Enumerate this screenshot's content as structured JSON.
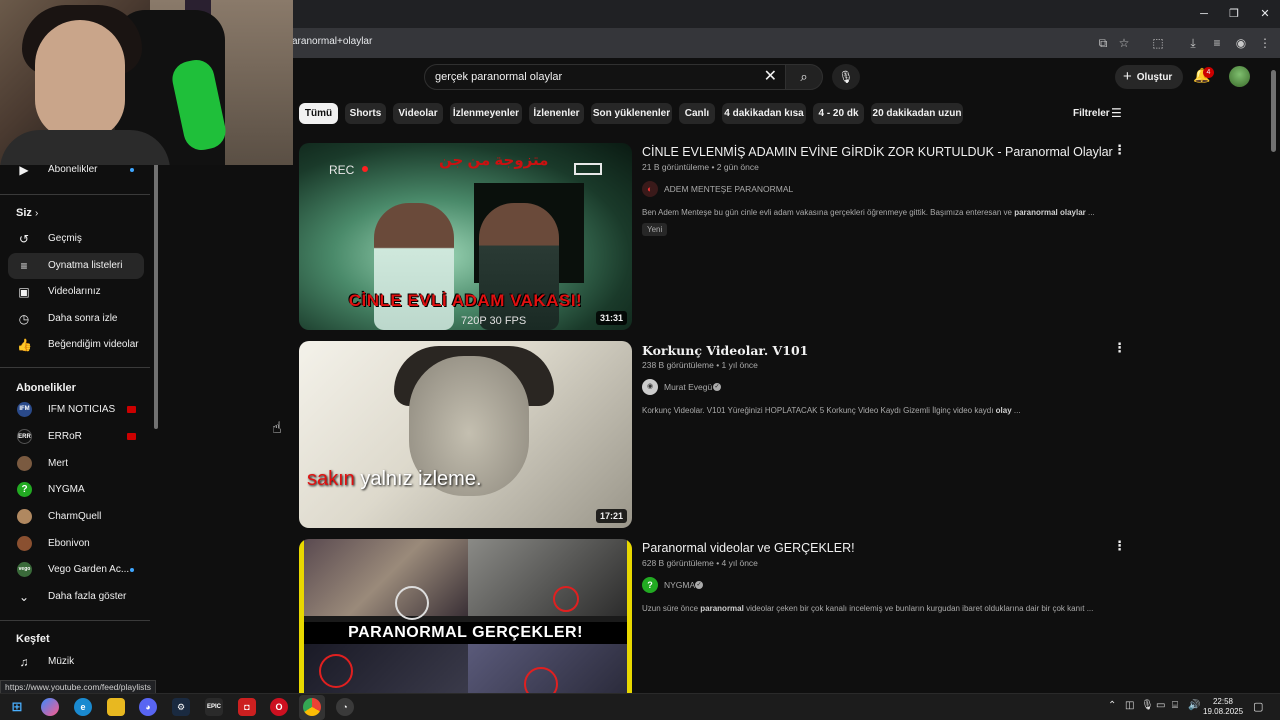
{
  "browser": {
    "url": "aranormal+olaylar",
    "status_url": "https://www.youtube.com/feed/playlists"
  },
  "topbar": {
    "search_query": "gerçek paranormal olaylar",
    "create_label": "Oluştur",
    "notification_count": "4"
  },
  "chips": [
    "Tümü",
    "Shorts",
    "Videolar",
    "İzlenmeyenler",
    "İzlenenler",
    "Son yüklenenler",
    "Canlı",
    "4 dakikadan kısa",
    "4 - 20 dk",
    "20 dakikadan uzun"
  ],
  "filters_label": "Filtreler",
  "sidebar": {
    "subscriptions_item": "Abonelikler",
    "you_header": "Siz",
    "you_items": [
      "Geçmiş",
      "Oynatma listeleri",
      "Videolarınız",
      "Daha sonra izle",
      "Beğendiğim videolar"
    ],
    "subs_header": "Abonelikler",
    "channels": [
      "IFM NOTICIAS",
      "ERRoR",
      "Mert",
      "NYGMA",
      "CharmQuell",
      "Ebonivon",
      "Vego Garden Ac..."
    ],
    "channel_avatar_text": [
      "IFM",
      "ERR",
      "",
      "?",
      "",
      "",
      "vego"
    ],
    "show_more": "Daha fazla göster",
    "explore_header": "Keşfet",
    "music": "Müzik"
  },
  "results": [
    {
      "title": "CİNLE EVLENMİŞ ADAMIN EVİNE GİRDİK ZOR KURTULDUK - Paranormal Olaylar",
      "meta": "21 B görüntüleme • 2 gün önce",
      "channel": "ADEM MENTEŞE PARANORMAL",
      "desc_pre": "Ben Adem Menteşe bu gün cinle evli adam vakasına gerçekleri öğrenmeye gittik. Başımıza enteresan ve ",
      "desc_bold": "paranormal olaylar",
      "desc_post": " ...",
      "badge": "Yeni",
      "duration": "31:31",
      "thumb_rec": "REC",
      "thumb_arabic": "متزوجة من جن",
      "thumb_caption": "CİNLE EVLİ ADAM VAKASI!",
      "thumb_fps": "720P 30 FPS"
    },
    {
      "title": "Korkunç Videolar. V101",
      "meta": "238 B görüntüleme • 1 yıl önce",
      "channel": "Murat Evegü",
      "desc_pre": "Korkunç Videolar. V101 Yüreğinizi HOPLATACAK 5 Korkunç Video Kaydı Gizemli İlginç video kaydı ",
      "desc_bold": "olay",
      "desc_post": " ...",
      "duration": "17:21",
      "thumb_cap_red": "sakın",
      "thumb_cap_white": " yalnız izleme."
    },
    {
      "title": "Paranormal videolar ve GERÇEKLER!",
      "meta": "628 B görüntüleme • 4 yıl önce",
      "channel": "NYGMA",
      "desc_pre": "Uzun süre önce ",
      "desc_bold": "paranormal",
      "desc_post": " videolar çeken bir çok kanalı incelemiş ve bunların kurgudan ibaret olduklarına dair bir çok kanıt ...",
      "thumb_caption": "PARANORMAL GERÇEKLER!"
    }
  ],
  "taskbar": {
    "time": "22:58",
    "date": "19.08.2025",
    "epic_label": "EPIC"
  }
}
